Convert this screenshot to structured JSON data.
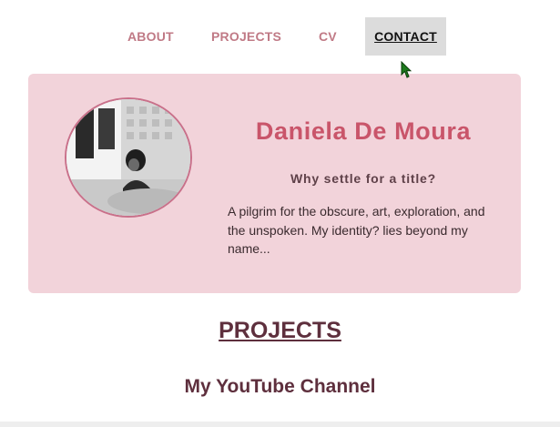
{
  "nav": {
    "items": [
      {
        "label": "ABOUT"
      },
      {
        "label": "PROJECTS"
      },
      {
        "label": "CV"
      },
      {
        "label": "CONTACT"
      }
    ]
  },
  "hero": {
    "name": "Daniela De Moura",
    "tagline": "Why settle for a title?",
    "bio": "A pilgrim for the obscure, art, exploration, and the unspoken. My identity? lies beyond my name..."
  },
  "projects": {
    "heading": "PROJECTS",
    "first_item_title": "My YouTube Channel"
  },
  "colors": {
    "accent_pink": "#c9556a",
    "card_bg": "#f2d3da",
    "nav_text": "#c07a86",
    "heading_text": "#5e2f3d"
  },
  "icons": {
    "cursor": "mouse-pointer-icon"
  }
}
